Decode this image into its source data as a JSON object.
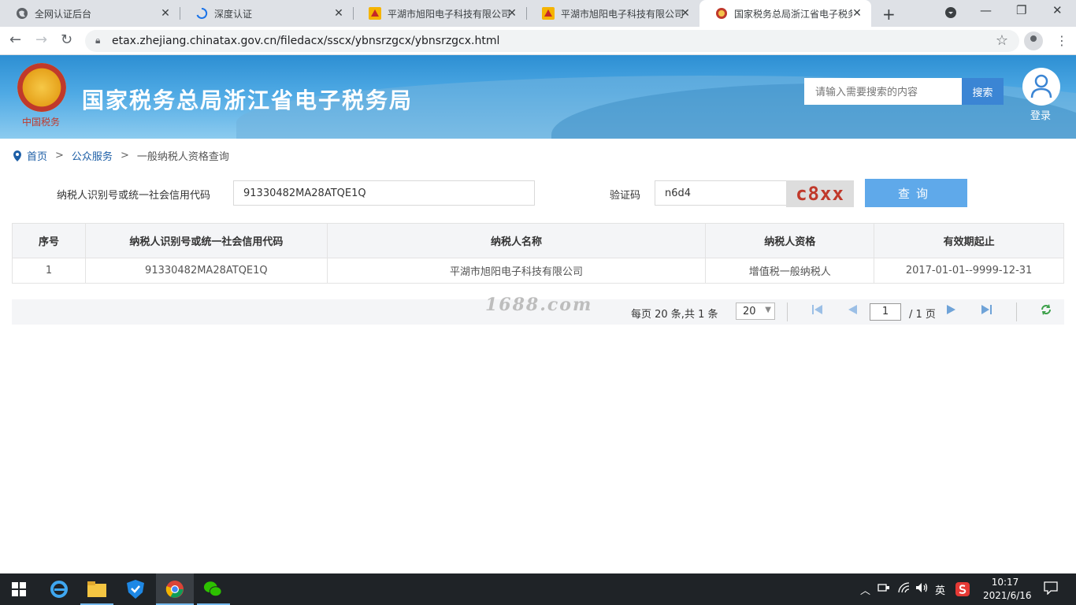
{
  "browser": {
    "tabs": [
      {
        "title": "全网认证后台"
      },
      {
        "title": "深度认证"
      },
      {
        "title": "平湖市旭阳电子科技有限公司"
      },
      {
        "title": "平湖市旭阳电子科技有限公司"
      },
      {
        "title": "国家税务总局浙江省电子税务局"
      }
    ],
    "url": "etax.zhejiang.chinatax.gov.cn/filedacx/sscx/ybnsrzgcx/ybnsrzgcx.html"
  },
  "header": {
    "emblem_text": "中国税务",
    "site_title": "国家税务总局浙江省电子税务局",
    "search_placeholder": "请输入需要搜索的内容",
    "search_button": "搜索",
    "login_label": "登录"
  },
  "breadcrumb": {
    "home": "首页",
    "sep1": ">",
    "public_service": "公众服务",
    "sep2": ">",
    "current": "一般纳税人资格查询"
  },
  "form": {
    "taxid_label": "纳税人识别号或统一社会信用代码",
    "taxid_value": "91330482MA28ATQE1Q",
    "captcha_label": "验证码",
    "captcha_value": "n6d4",
    "captcha_image_text": "c8xx",
    "query_button": "查询"
  },
  "table": {
    "headers": [
      "序号",
      "纳税人识别号或统一社会信用代码",
      "纳税人名称",
      "纳税人资格",
      "有效期起止"
    ],
    "rows": [
      [
        "1",
        "91330482MA28ATQE1Q",
        "平湖市旭阳电子科技有限公司",
        "增值税一般纳税人",
        "2017-01-01--9999-12-31"
      ]
    ]
  },
  "pager": {
    "watermark": "1688.com",
    "summary": "每页 20 条,共 1 条",
    "page_size": "20",
    "current_page": "1",
    "total_pages": "/ 1 页"
  },
  "taskbar": {
    "ime": "英",
    "time": "10:17",
    "date": "2021/6/16"
  },
  "colors": {
    "banner_blue": "#2d8fd3",
    "query_button": "#5fa9ea",
    "link": "#1c5ea6"
  }
}
